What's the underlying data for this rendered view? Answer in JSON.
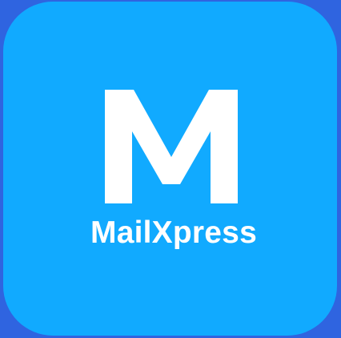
{
  "app": {
    "logo_letter": "M",
    "name": "MailXpress"
  },
  "icons": {
    "logo": "mail-logo-m-icon"
  },
  "colors": {
    "background": "#2f64e0",
    "icon_fill": "#11aaff",
    "foreground": "#ffffff"
  }
}
